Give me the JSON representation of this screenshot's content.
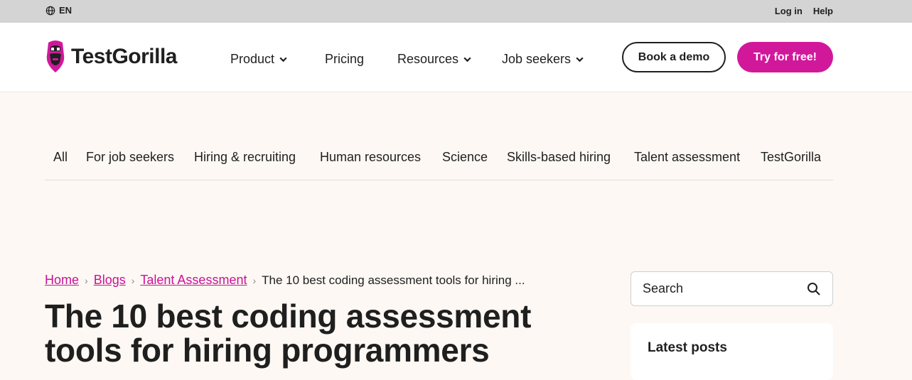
{
  "topbar": {
    "language": "EN",
    "login": "Log in",
    "help": "Help"
  },
  "header": {
    "logo_text": "TestGorilla",
    "nav": [
      {
        "label": "Product",
        "has_dropdown": true
      },
      {
        "label": "Pricing",
        "has_dropdown": false
      },
      {
        "label": "Resources",
        "has_dropdown": true
      },
      {
        "label": "Job seekers",
        "has_dropdown": true
      }
    ],
    "book_demo": "Book a demo",
    "try_free": "Try for free!"
  },
  "categories": [
    "All",
    "For job seekers",
    "Hiring & recruiting",
    "Human resources",
    "Science",
    "Skills-based hiring",
    "Talent assessment",
    "TestGorilla"
  ],
  "breadcrumb": {
    "home": "Home",
    "blogs": "Blogs",
    "section": "Talent Assessment",
    "current": "The 10 best coding assessment tools for hiring ..."
  },
  "article": {
    "title": "The 10 best coding assessment tools for hiring programmers"
  },
  "sidebar": {
    "search_placeholder": "Search",
    "latest_title": "Latest posts"
  },
  "colors": {
    "brand_magenta": "#d1189b",
    "page_bg": "#fdf8f3",
    "topbar_bg": "#d4d4d4"
  }
}
